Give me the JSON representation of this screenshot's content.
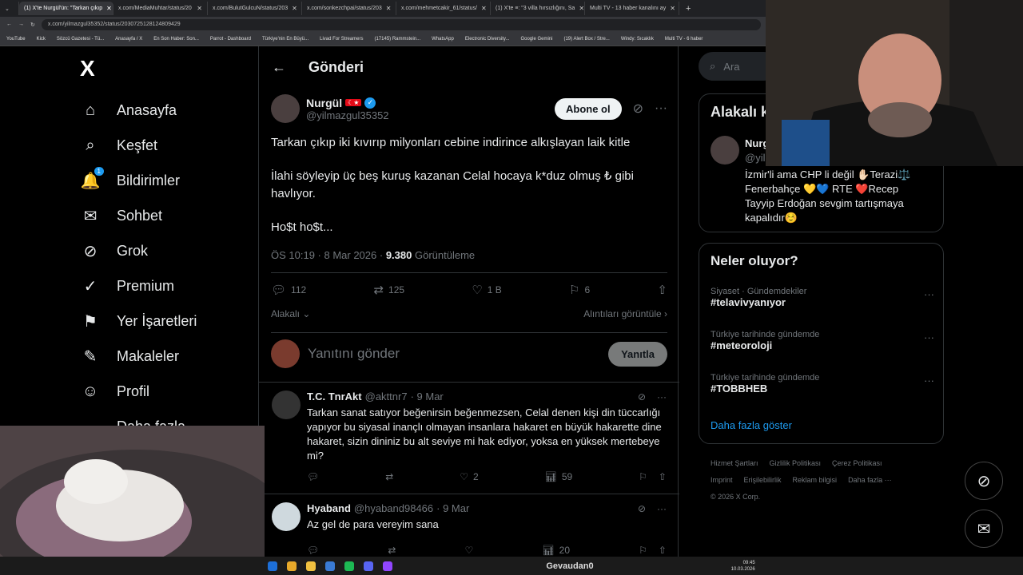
{
  "browser": {
    "tabs": [
      {
        "title": "(1) X'te Nurgül'ün: \"Tarkan çıkıp",
        "active": true
      },
      {
        "title": "x.com/MediaMuhtar/status/20",
        "active": false
      },
      {
        "title": "x.com/BulutGulcuN/status/203",
        "active": false
      },
      {
        "title": "x.com/sonkezchpai/status/203",
        "active": false
      },
      {
        "title": "x.com/mehmetcakir_61/status/",
        "active": false
      },
      {
        "title": "(1) X'te ≡: \"3 villa hırsızlığını, Sa",
        "active": false
      },
      {
        "title": "Multi TV - 13 haber kanalını ay",
        "active": false
      }
    ],
    "url": "x.com/yilmazgul35352/status/2030725128124809429",
    "bookmarks": [
      "YouTube",
      "Kick",
      "Sözcü Gazetesi - Tü...",
      "Anasayfa / X",
      "En Son Haber: Son...",
      "Parrot - Dashboard",
      "Türkiye'nin En Büyü...",
      "Livad For Streamers",
      "(17145) Rammstein...",
      "WhatsApp",
      "Electronic Diversity...",
      "Google Gemini",
      "(19) Alert Box / Stre...",
      "Windy: Sıcaklık",
      "Multi TV - 6 haber"
    ]
  },
  "nav": {
    "logo": "X",
    "items": [
      {
        "label": "Anasayfa",
        "icon": "home-icon",
        "glyph": "⌂"
      },
      {
        "label": "Keşfet",
        "icon": "search-icon",
        "glyph": "⌕"
      },
      {
        "label": "Bildirimler",
        "icon": "bell-icon",
        "glyph": "🔔",
        "badge": "1"
      },
      {
        "label": "Sohbet",
        "icon": "mail-icon",
        "glyph": "✉"
      },
      {
        "label": "Grok",
        "icon": "grok-icon",
        "glyph": "⊘"
      },
      {
        "label": "Premium",
        "icon": "premium-icon",
        "glyph": "✓"
      },
      {
        "label": "Yer İşaretleri",
        "icon": "bookmark-icon",
        "glyph": "⚑"
      },
      {
        "label": "Makaleler",
        "icon": "article-icon",
        "glyph": "✎"
      },
      {
        "label": "Profil",
        "icon": "profile-icon",
        "glyph": "☺"
      },
      {
        "label": "Daha fazla",
        "icon": "more-icon",
        "glyph": "⋯"
      }
    ]
  },
  "header": {
    "title": "Gönderi"
  },
  "tweet": {
    "name": "Nurgül",
    "handle": "@yilmazgul35352",
    "follow_label": "Abone ol",
    "line1": "Tarkan çıkıp iki kıvırıp milyonları cebine indirince alkışlayan laik kitle",
    "line2": "İlahi söyleyip üç beş kuruş kazanan Celal hocaya k*duz olmuş ₺ gibi havlıyor.",
    "line3": "Ho$t ho$t...",
    "time": "ÖS 10:19 · 8 Mar 2026 ·",
    "views": "9.380",
    "views_label": "Görüntüleme",
    "replies": "112",
    "retweets": "125",
    "likes": "1 B",
    "bookmarks": "6",
    "sort_label": "Alakalı",
    "quotes_label": "Alıntıları görüntüle"
  },
  "composer": {
    "placeholder": "Yanıtını gönder",
    "button": "Yanıtla"
  },
  "replies": [
    {
      "name": "T.C. TnrAkt",
      "handle": "@akttnr7",
      "date": "· 9 Mar",
      "text": "Tarkan sanat satıyor beğenirsin beğenmezsen, Celal denen kişi din tüccarlığı yapıyor bu siyasal inançlı olmayan insanlara hakaret en büyük hakarette dine hakaret, sizin dininiz bu alt seviye mi hak ediyor, yoksa en yüksek mertebeye mi?",
      "likes": "2",
      "views": "59"
    },
    {
      "name": "Hyaband",
      "handle": "@hyaband98466",
      "date": "· 9 Mar",
      "text": "Az gel de para vereyim sana",
      "likes": "",
      "views": "20"
    }
  ],
  "search": {
    "placeholder": "Ara"
  },
  "related": {
    "title": "Alakalı k",
    "name": "Nurg",
    "handle": "@yil",
    "bio": "İzmir'li ama CHP li değil ✋🏻Terazi⚖️ Fenerbahçe 💛💙 RTE ❤️Recep Tayyip Erdoğan sevgim tartışmaya kapalıdır☺️"
  },
  "trends": {
    "title": "Neler oluyor?",
    "items": [
      {
        "category": "Siyaset · Gündemdekiler",
        "tag": "#telavivyanıyor"
      },
      {
        "category": "Türkiye tarihinde gündemde",
        "tag": "#meteoroloji"
      },
      {
        "category": "Türkiye tarihinde gündemde",
        "tag": "#TOBBHEB"
      }
    ],
    "show_more": "Daha fazla göster"
  },
  "footer": {
    "links": [
      "Hizmet Şartları",
      "Gizlilik Politikası",
      "Çerez Politikası",
      "Imprint",
      "Erişilebilirlik",
      "Reklam bilgisi",
      "Daha fazla ···"
    ],
    "copyright": "© 2026 X Corp."
  },
  "taskbar": {
    "stream_user": "Gevaudan0",
    "time": "09:45",
    "date": "10.03.2026"
  },
  "colors": {
    "accent": "#1d9bf0",
    "background": "#000000",
    "border": "#2f3336",
    "muted": "#71767b"
  }
}
